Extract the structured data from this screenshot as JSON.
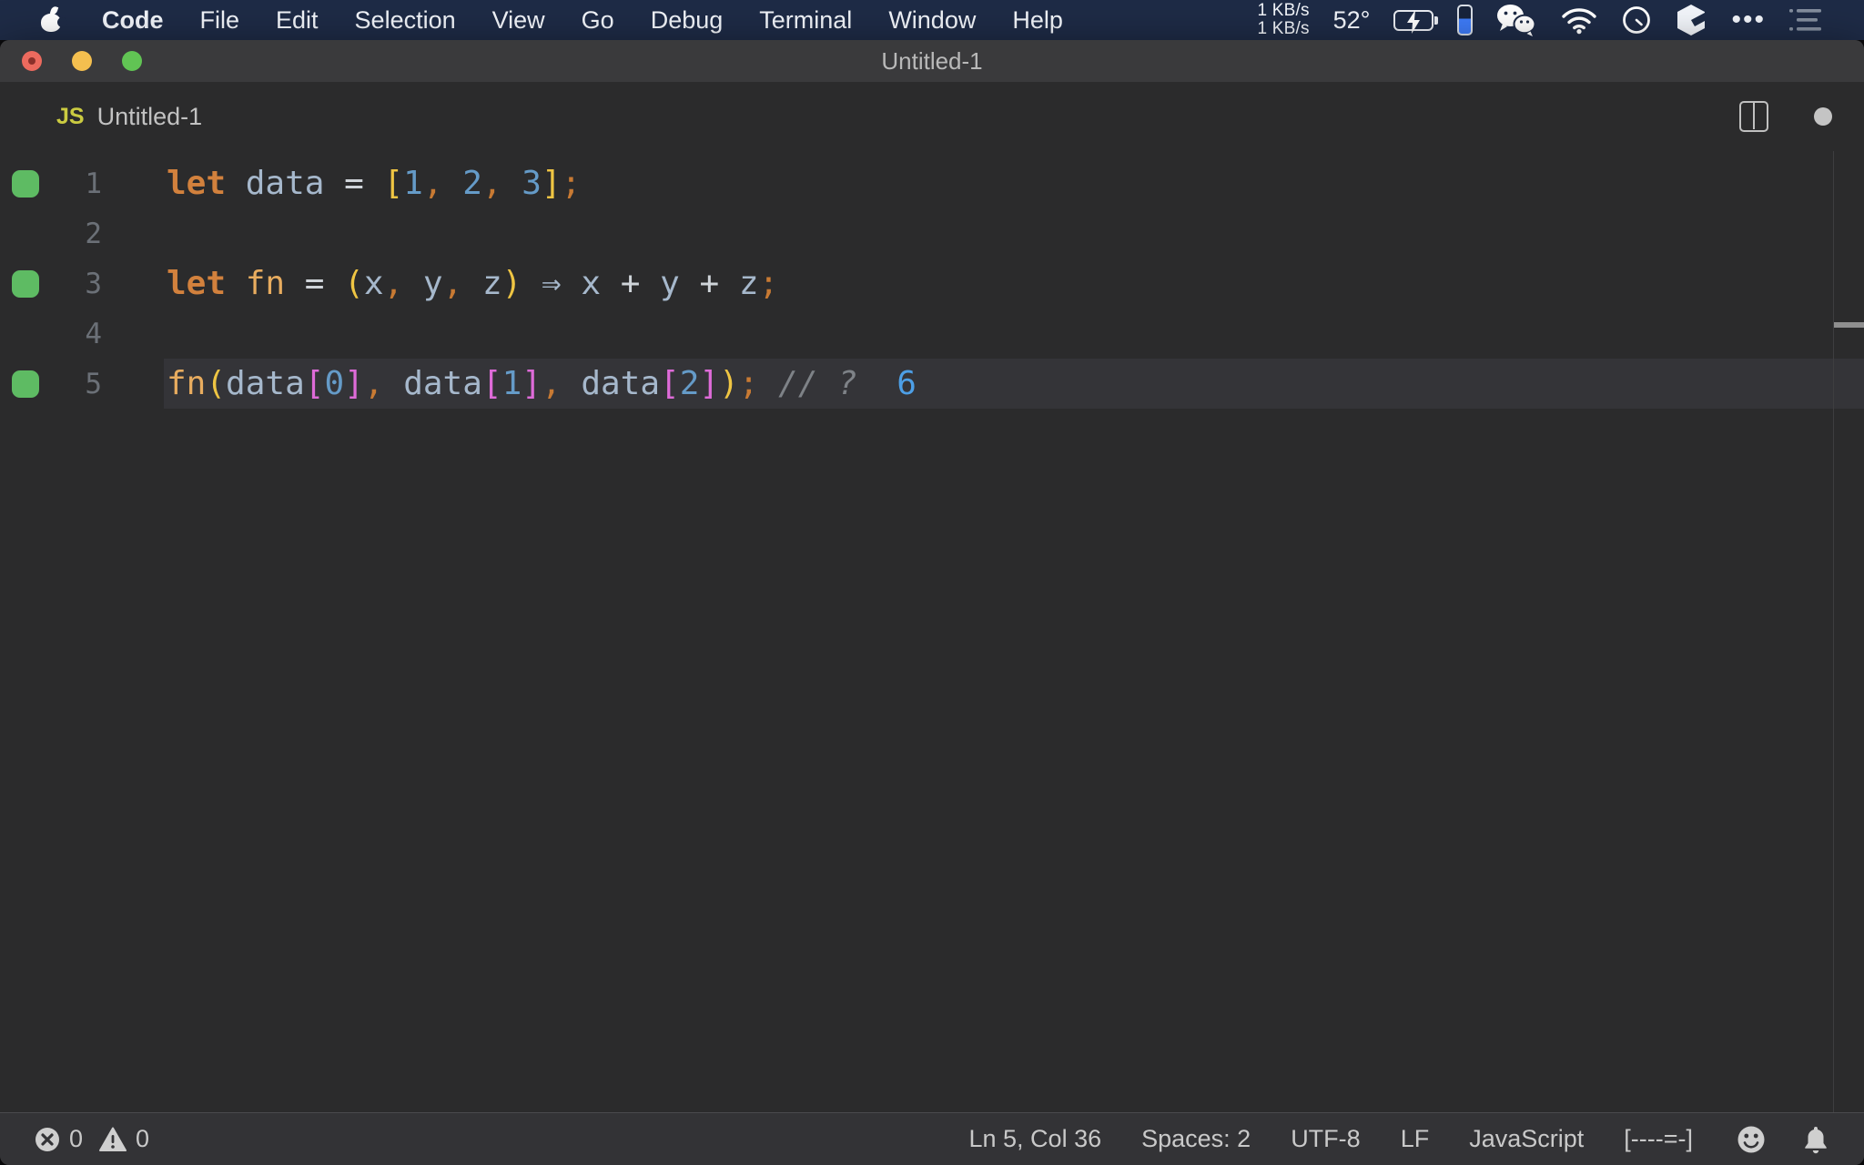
{
  "menu_bar": {
    "apple_icon": "apple-logo-icon",
    "items": [
      "Code",
      "File",
      "Edit",
      "Selection",
      "View",
      "Go",
      "Debug",
      "Terminal",
      "Window",
      "Help"
    ],
    "status": {
      "net_up": "1 KB/s",
      "net_down": "1 KB/s",
      "temperature": "52°",
      "icons": [
        "battery-charging-icon",
        "battery-level-pill-icon",
        "wechat-icon",
        "wifi-icon",
        "clock-icon",
        "box-icon",
        "ellipsis-icon",
        "list-icon"
      ]
    }
  },
  "window": {
    "title": "Untitled-1",
    "traffic_lights": [
      "close",
      "minimize",
      "zoom"
    ]
  },
  "tab": {
    "icon": "JS",
    "label": "Untitled-1",
    "actions": [
      "split-editor-icon",
      "dirty-dot-icon"
    ]
  },
  "editor": {
    "code_text": [
      "let data = [1, 2, 3];",
      "",
      "let fn = (x, y, z) ⇒ x + y + z;",
      "",
      "fn(data[0], data[1], data[2]); // ?  6"
    ],
    "lines": [
      {
        "number": "1",
        "covered": true,
        "current": false,
        "tokens": [
          [
            "let",
            "kw"
          ],
          [
            " ",
            "plain"
          ],
          [
            "data",
            "var"
          ],
          [
            " ",
            "plain"
          ],
          [
            "=",
            "op"
          ],
          [
            " ",
            "plain"
          ],
          [
            "[",
            "br1"
          ],
          [
            "1",
            "num"
          ],
          [
            ",",
            "punct"
          ],
          [
            " ",
            "plain"
          ],
          [
            "2",
            "num"
          ],
          [
            ",",
            "punct"
          ],
          [
            " ",
            "plain"
          ],
          [
            "3",
            "num"
          ],
          [
            "]",
            "br1"
          ],
          [
            ";",
            "punct"
          ]
        ]
      },
      {
        "number": "2",
        "covered": false,
        "current": false,
        "tokens": []
      },
      {
        "number": "3",
        "covered": true,
        "current": false,
        "tokens": [
          [
            "let",
            "kw"
          ],
          [
            " ",
            "plain"
          ],
          [
            "fn",
            "fn"
          ],
          [
            " ",
            "plain"
          ],
          [
            "=",
            "op"
          ],
          [
            " ",
            "plain"
          ],
          [
            "(",
            "br1"
          ],
          [
            "x",
            "var"
          ],
          [
            ",",
            "punct"
          ],
          [
            " ",
            "plain"
          ],
          [
            "y",
            "var"
          ],
          [
            ",",
            "punct"
          ],
          [
            " ",
            "plain"
          ],
          [
            "z",
            "var"
          ],
          [
            ")",
            "br1"
          ],
          [
            " ",
            "plain"
          ],
          [
            "⇒",
            "arrow"
          ],
          [
            " ",
            "plain"
          ],
          [
            "x",
            "var"
          ],
          [
            " ",
            "plain"
          ],
          [
            "+",
            "op"
          ],
          [
            " ",
            "plain"
          ],
          [
            "y",
            "var"
          ],
          [
            " ",
            "plain"
          ],
          [
            "+",
            "op"
          ],
          [
            " ",
            "plain"
          ],
          [
            "z",
            "var"
          ],
          [
            ";",
            "punct"
          ]
        ]
      },
      {
        "number": "4",
        "covered": false,
        "current": false,
        "tokens": []
      },
      {
        "number": "5",
        "covered": true,
        "current": true,
        "tokens": [
          [
            "fn",
            "fn"
          ],
          [
            "(",
            "br1"
          ],
          [
            "data",
            "var"
          ],
          [
            "[",
            "br2"
          ],
          [
            "0",
            "num"
          ],
          [
            "]",
            "br2"
          ],
          [
            ",",
            "punct"
          ],
          [
            " ",
            "plain"
          ],
          [
            "data",
            "var"
          ],
          [
            "[",
            "br2"
          ],
          [
            "1",
            "num"
          ],
          [
            "]",
            "br2"
          ],
          [
            ",",
            "punct"
          ],
          [
            " ",
            "plain"
          ],
          [
            "data",
            "var"
          ],
          [
            "[",
            "br2"
          ],
          [
            "2",
            "num"
          ],
          [
            "]",
            "br2"
          ],
          [
            ")",
            "br1"
          ],
          [
            ";",
            "punct"
          ],
          [
            " ",
            "plain"
          ],
          [
            "// ?",
            "comment"
          ],
          [
            "  ",
            "plain"
          ],
          [
            "6",
            "val"
          ]
        ]
      }
    ]
  },
  "status_bar": {
    "errors": "0",
    "warnings": "0",
    "cursor": "Ln 5, Col 36",
    "indent": "Spaces: 2",
    "encoding": "UTF-8",
    "eol": "LF",
    "language": "JavaScript",
    "indicator": "[----=-]",
    "icons": [
      "error-icon",
      "warning-icon",
      "feedback-smiley-icon",
      "notifications-bell-icon"
    ]
  },
  "colors": {
    "menubar_bg": "#1E2B46",
    "titlebar_bg": "#3A3A3C",
    "editor_bg": "#2B2B2C",
    "current_line_bg": "#343438",
    "statusbar_bg": "#333336",
    "quokka_coverage": "#5EBB63",
    "keyword": "#D2813D",
    "function": "#E8AC5F",
    "variable": "#A6B8CC",
    "bracket_yellow": "#EFC543",
    "bracket_magenta": "#DE6BD8",
    "number": "#659BC8",
    "punctuation": "#C87A33",
    "comment": "#7E8287",
    "quokka_value": "#4D9FE6",
    "js_badge": "#CBCB41"
  }
}
